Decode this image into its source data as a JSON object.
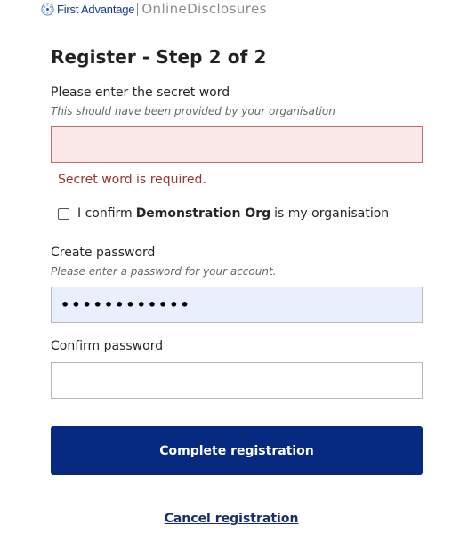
{
  "header": {
    "brand": "First Advantage",
    "app_name": "OnlineDisclosures",
    "logo_icon": "globe-icon"
  },
  "page_title": "Register - Step 2 of 2",
  "secret_word": {
    "label": "Please enter the secret word",
    "hint": "This should have been provided by your organisation",
    "value": "",
    "error": "Secret word is required."
  },
  "confirm_org": {
    "prefix": "I confirm",
    "org": "Demonstration Org",
    "suffix": "is my organisation",
    "checked": false
  },
  "create_password": {
    "label": "Create password",
    "hint": "Please enter a password for your account.",
    "masked_value": "••••••••••••"
  },
  "confirm_password": {
    "label": "Confirm password",
    "value": ""
  },
  "actions": {
    "submit_label": "Complete registration",
    "cancel_label": "Cancel registration"
  },
  "colors": {
    "primary": "#052a80",
    "error_bg": "#fae7e7",
    "error_text": "#9a3434",
    "autofill_bg": "#e8f0fe"
  }
}
